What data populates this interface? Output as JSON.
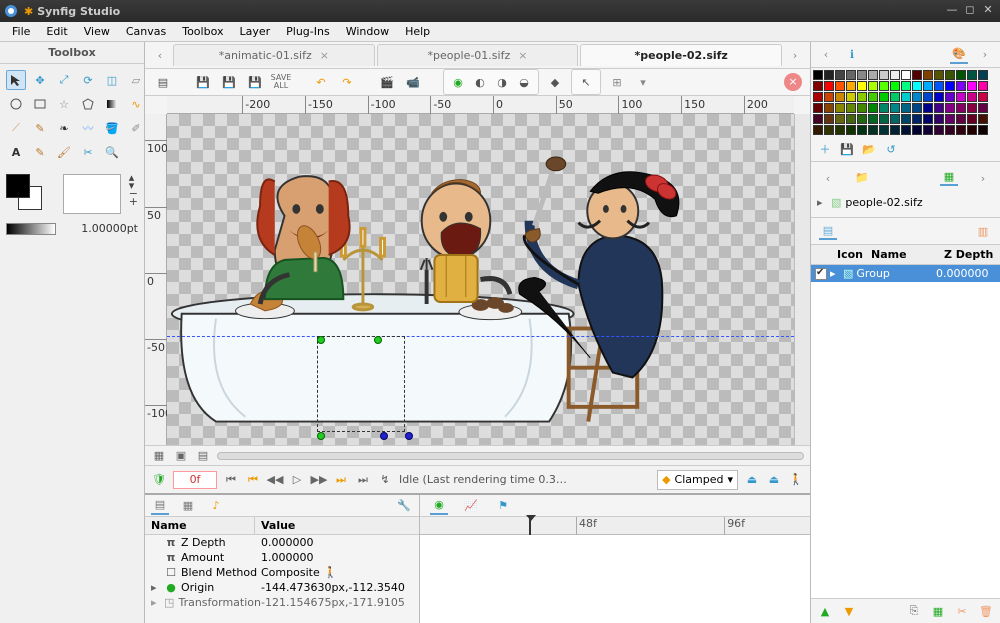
{
  "window": {
    "title": "Synfig Studio"
  },
  "menubar": [
    "File",
    "Edit",
    "View",
    "Canvas",
    "Toolbox",
    "Layer",
    "Plug-Ins",
    "Window",
    "Help"
  ],
  "toolbox": {
    "header": "Toolbox",
    "stroke_width": "1.00000pt"
  },
  "documents": {
    "tabs": [
      {
        "label": "*animatic-01.sifz",
        "active": false
      },
      {
        "label": "*people-01.sifz",
        "active": false
      },
      {
        "label": "*people-02.sifz",
        "active": true
      }
    ]
  },
  "ruler_top": [
    {
      "pos": 5,
      "label": ""
    },
    {
      "pos": 12,
      "label": "-200"
    },
    {
      "pos": 22,
      "label": "-150"
    },
    {
      "pos": 32,
      "label": "-100"
    },
    {
      "pos": 42,
      "label": "-50"
    },
    {
      "pos": 52,
      "label": "0"
    },
    {
      "pos": 62,
      "label": "50"
    },
    {
      "pos": 72,
      "label": "100"
    },
    {
      "pos": 82,
      "label": "150"
    },
    {
      "pos": 92,
      "label": "200"
    }
  ],
  "ruler_left": [
    {
      "pos": 8,
      "label": "100"
    },
    {
      "pos": 28,
      "label": "50"
    },
    {
      "pos": 48,
      "label": "0"
    },
    {
      "pos": 68,
      "label": "-50"
    },
    {
      "pos": 88,
      "label": "-100"
    }
  ],
  "transport": {
    "frame": "0f",
    "status": "Idle (Last rendering time 0.3…",
    "interp": "Clamped"
  },
  "params": {
    "headers": {
      "name": "Name",
      "value": "Value"
    },
    "rows": [
      {
        "icon": "π",
        "name": "Z Depth",
        "value": "0.000000"
      },
      {
        "icon": "π",
        "name": "Amount",
        "value": "1.000000"
      },
      {
        "icon": "blend",
        "name": "Blend Method",
        "value": "Composite"
      },
      {
        "icon": "origin",
        "name": "Origin",
        "value": "-144.473630px,-112.3540"
      },
      {
        "icon": "xform",
        "name": "Transformation",
        "value": "-121.154675px,-171.9105"
      }
    ]
  },
  "timeline": [
    "",
    "48f",
    "96f"
  ],
  "navigator_item": "people-02.sifz",
  "layers": {
    "headers": [
      "",
      "Icon",
      "Name",
      "Z Depth"
    ],
    "row": {
      "name": "Group",
      "z": "0.000000"
    }
  },
  "palette": [
    "#000000",
    "#222222",
    "#444444",
    "#666666",
    "#888888",
    "#aaaaaa",
    "#cccccc",
    "#eeeeee",
    "#ffffff",
    "#550000",
    "#804000",
    "#555500",
    "#3a5500",
    "#005500",
    "#005540",
    "#004055",
    "#800000",
    "#ff0000",
    "#ff5500",
    "#ffaa00",
    "#ffff00",
    "#aaff00",
    "#55ff00",
    "#00ff00",
    "#00ff80",
    "#00ffff",
    "#00aaff",
    "#0055ff",
    "#0000ff",
    "#8000ff",
    "#ff00ff",
    "#ff00aa",
    "#aa0000",
    "#cc4400",
    "#cc8800",
    "#cccc00",
    "#88cc00",
    "#44cc00",
    "#00cc00",
    "#00cc66",
    "#00cccc",
    "#0088cc",
    "#0044cc",
    "#0000cc",
    "#6600cc",
    "#cc00cc",
    "#cc0088",
    "#cc0044",
    "#660000",
    "#884400",
    "#888800",
    "#668800",
    "#448800",
    "#008800",
    "#008866",
    "#008888",
    "#006688",
    "#004488",
    "#000088",
    "#440088",
    "#880088",
    "#880066",
    "#880044",
    "#660044",
    "#440022",
    "#663311",
    "#666611",
    "#446611",
    "#226611",
    "#006622",
    "#006644",
    "#006666",
    "#004466",
    "#002266",
    "#000066",
    "#330066",
    "#660066",
    "#660044",
    "#660022",
    "#441100",
    "#331800",
    "#333300",
    "#223300",
    "#113300",
    "#003311",
    "#003322",
    "#003333",
    "#002233",
    "#001133",
    "#000033",
    "#110033",
    "#330033",
    "#330022",
    "#330011",
    "#220000",
    "#110000"
  ]
}
